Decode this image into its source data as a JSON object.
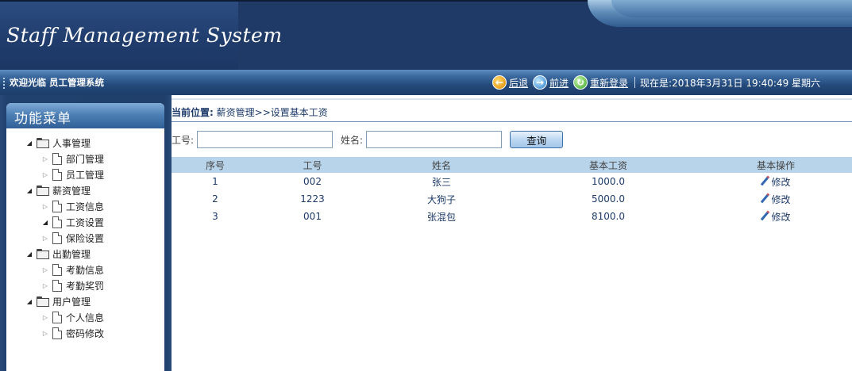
{
  "header": {
    "app_title": "Staff Management System"
  },
  "infobar": {
    "welcome": "欢迎光临 员工管理系统",
    "back_label": "后退",
    "forward_label": "前进",
    "relogin_label": "重新登录",
    "now_text": "现在是:2018年3月31日 19:40:49 星期六"
  },
  "sidebar": {
    "title": "功能菜单",
    "groups": [
      {
        "label": "人事管理",
        "items": [
          "部门管理",
          "员工管理"
        ]
      },
      {
        "label": "薪资管理",
        "items": [
          "工资信息",
          "工资设置",
          "保险设置"
        ]
      },
      {
        "label": "出勤管理",
        "items": [
          "考勤信息",
          "考勤奖罚"
        ]
      },
      {
        "label": "用户管理",
        "items": [
          "个人信息",
          "密码修改"
        ]
      }
    ]
  },
  "main": {
    "breadcrumb_label": "当前位置:",
    "breadcrumb_path": "薪资管理>>设置基本工资",
    "search": {
      "id_label": "工号:",
      "id_value": "",
      "name_label": "姓名:",
      "name_value": "",
      "button": "查询"
    },
    "table": {
      "headers": [
        "序号",
        "工号",
        "姓名",
        "基本工资",
        "基本操作"
      ],
      "rows": [
        [
          "1",
          "002",
          "张三",
          "1000.0",
          "修改"
        ],
        [
          "2",
          "1223",
          "大狗子",
          "5000.0",
          "修改"
        ],
        [
          "3",
          "001",
          "张混包",
          "8100.0",
          "修改"
        ]
      ]
    }
  },
  "colors": {
    "banner": "#1f3a66",
    "table_header": "#b8d4ea",
    "link_text": "#1c3a6a"
  }
}
